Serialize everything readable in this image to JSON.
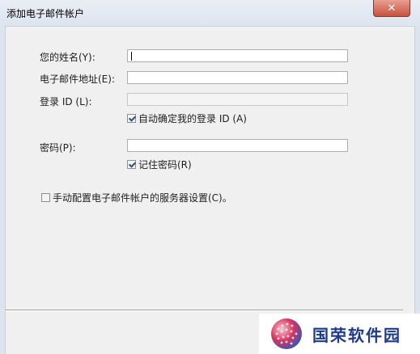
{
  "window": {
    "title": "添加电子邮件帐户",
    "close_glyph": "✕"
  },
  "form": {
    "name_label": "您的姓名(Y):",
    "email_label": "电子邮件地址(E):",
    "login_label": "登录 ID (L):",
    "auto_login_label": "自动确定我的登录 ID (A)",
    "password_label": "密码(P):",
    "remember_label": "记住密码(R)",
    "manual_config_label": "手动配置电子邮件帐户的服务器设置(C)。"
  },
  "values": {
    "name": "",
    "email": "",
    "login": "",
    "password": ""
  },
  "states": {
    "auto_login": true,
    "remember_password": true,
    "manual_config": false,
    "login_enabled": false
  },
  "watermark": {
    "text": "国荣软件园"
  },
  "colors": {
    "watermark_text": "#1e3a8a",
    "close": "#c7503f"
  }
}
